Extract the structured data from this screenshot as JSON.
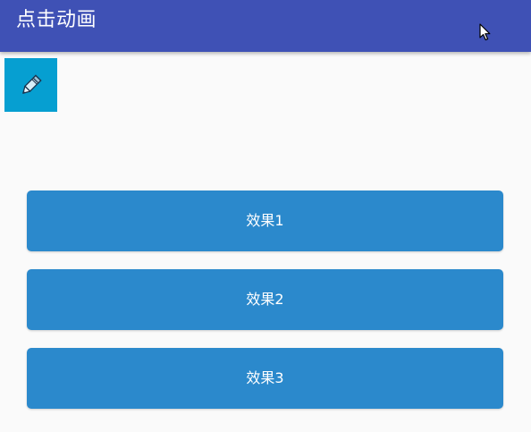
{
  "app_bar": {
    "title": "点击动画",
    "background": "#3f51b5"
  },
  "edit_tile": {
    "icon": "pencil-icon",
    "background": "#069fd1"
  },
  "buttons": [
    {
      "label": "效果1"
    },
    {
      "label": "效果2"
    },
    {
      "label": "效果3"
    }
  ],
  "colors": {
    "button": "#2b89cc",
    "page_background": "#fafafa"
  }
}
